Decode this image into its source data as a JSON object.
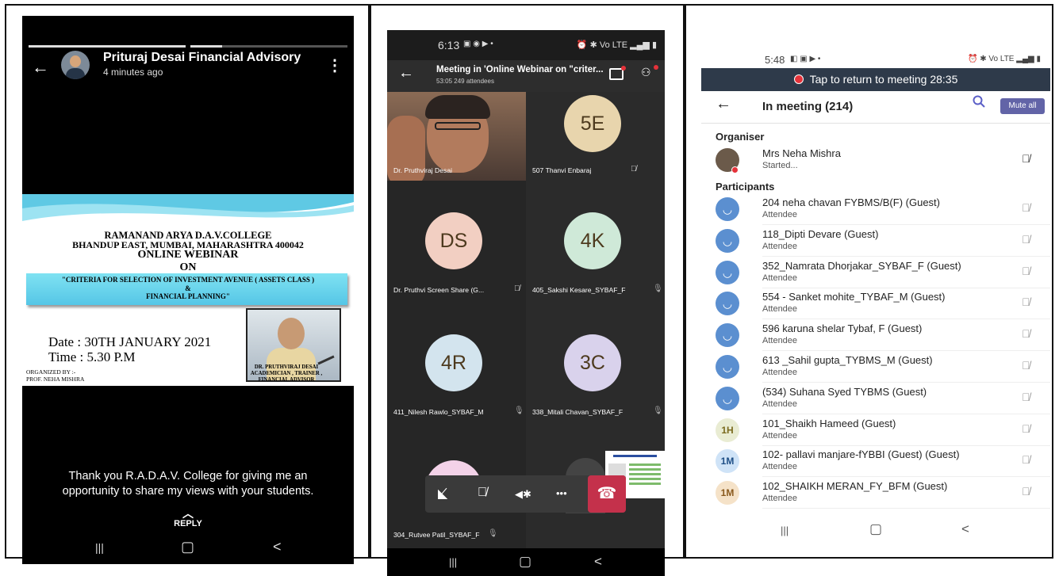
{
  "panel1": {
    "name": "Prituraj Desai Financial Advisory",
    "time": "4 minutes ago",
    "back_icon": "←",
    "menu_icon": "⋮",
    "poster": {
      "line1": "RAMANAND ARYA D.A.V.COLLEGE",
      "line2": "BHANDUP EAST, MUMBAI, MAHARASHTRA 400042",
      "line3": "ONLINE WEBINAR",
      "line4": "ON",
      "line5": "\"CRITERIA FOR SELECTION OF  INVESTMENT AVENUE ( ASSETS CLASS )",
      "line6": "&",
      "line7": "FINANCIAL PLANNING\"",
      "date": "Date : 30TH  JANUARY  2021",
      "time": "Time :  5.30 P.M",
      "organized_by": "ORGANIZED BY :-",
      "organizer": "PROF. NEHA MISHRA",
      "caption1": "DR. PRUTHVIRAJ  DESAI",
      "caption2": "ACADEMICIAN , TRAINER ,",
      "caption3": "FINANCIAL  ADVISOR"
    },
    "message_line1": "Thank you R.A.D.A.V. College for giving me an",
    "message_line2": "opportunity to share my views with your students.",
    "reply_icon": "︿",
    "reply": "REPLY"
  },
  "panel2": {
    "status_time": "6:13",
    "status_left_icons": "▣ ◉ ▶ •",
    "status_right_icons": "⏰ ✱ Vo LTE ▂▄▆ ▮",
    "back_icon": "←",
    "title": "Meeting in 'Online Webinar on \"criter...",
    "subtitle": "53:05  249 attendees",
    "people_icon": "⚇",
    "tiles": [
      {
        "label": "Dr. Pruthviraj Desai",
        "initials": "",
        "color": "#ffffff"
      },
      {
        "label": "507 Thanvi Enbaraj",
        "initials": "5E",
        "color": "#e8d5ad"
      },
      {
        "label": "Dr. Pruthvi Screen Share (G...",
        "initials": "DS",
        "color": "#f2cfc2"
      },
      {
        "label": "405_Sakshi Kesare_SYBAF_F",
        "initials": "4K",
        "color": "#cfe9d8"
      },
      {
        "label": "411_Nilesh Rawlo_SYBAF_M",
        "initials": "4R",
        "color": "#d3e4ee"
      },
      {
        "label": "338_Mitali Chavan_SYBAF_F",
        "initials": "3C",
        "color": "#d9d2ec"
      },
      {
        "label": "304_Rutvee Patil_SYBAF_F",
        "initials": "",
        "color": "#f3d2e8"
      }
    ],
    "muted_icon": "🎙̸",
    "mic_icon": "🎙",
    "controls": {
      "video_off": "◣̸",
      "mic_off": "🎙̸",
      "speaker": "◀✱",
      "more": "•••",
      "hangup": "☎"
    },
    "nav": {
      "recent": "|||",
      "home": "▢",
      "back": "<"
    }
  },
  "panel3": {
    "status_time": "5:48",
    "status_left_icons": "◧ ▣ ▶ •",
    "status_right_icons": "⏰ ✱ Vo LTE ▂▄▆ ▮",
    "banner": "Tap to return to meeting 28:35",
    "back_icon": "←",
    "title": "In meeting (214)",
    "search_icon": "🔍",
    "mute_all": "Mute all",
    "organiser_heading": "Organiser",
    "organiser": {
      "name": "Mrs Neha Mishra",
      "status": "Started..."
    },
    "participants_heading": "Participants",
    "participants": [
      {
        "name": "204 neha chavan FYBMS/B(F) (Guest)",
        "role": "Attendee",
        "avatar": "◡",
        "avatar_type": "icon"
      },
      {
        "name": "118_Dipti Devare (Guest)",
        "role": "Attendee",
        "avatar": "◡",
        "avatar_type": "icon"
      },
      {
        "name": "352_Namrata Dhorjakar_SYBAF_F (Guest)",
        "role": "Attendee",
        "avatar": "◡",
        "avatar_type": "icon"
      },
      {
        "name": "554 - Sanket mohite_TYBAF_M (Guest)",
        "role": "Attendee",
        "avatar": "◡",
        "avatar_type": "icon"
      },
      {
        "name": "596  karuna shelar Tybaf, F (Guest)",
        "role": "Attendee",
        "avatar": "◡",
        "avatar_type": "icon"
      },
      {
        "name": "613 _Sahil gupta_TYBMS_M (Guest)",
        "role": "Attendee",
        "avatar": "◡",
        "avatar_type": "icon"
      },
      {
        "name": "(534) Suhana Syed TYBMS (Guest)",
        "role": "Attendee",
        "avatar": "◡",
        "avatar_type": "icon"
      },
      {
        "name": "101_Shaikh Hameed (Guest)",
        "role": "Attendee",
        "avatar": "1H",
        "avatar_type": "init"
      },
      {
        "name": "102- pallavi manjare-fYBBI (Guest) (Guest)",
        "role": "Attendee",
        "avatar": "1M",
        "avatar_type": "init2"
      },
      {
        "name": "102_SHAIKH MERAN_FY_BFM  (Guest)",
        "role": "Attendee",
        "avatar": "1M",
        "avatar_type": "init3"
      }
    ],
    "mic_off_icon": "🎙̸",
    "nav": {
      "recent": "|||",
      "home": "▢",
      "back": "<"
    }
  }
}
